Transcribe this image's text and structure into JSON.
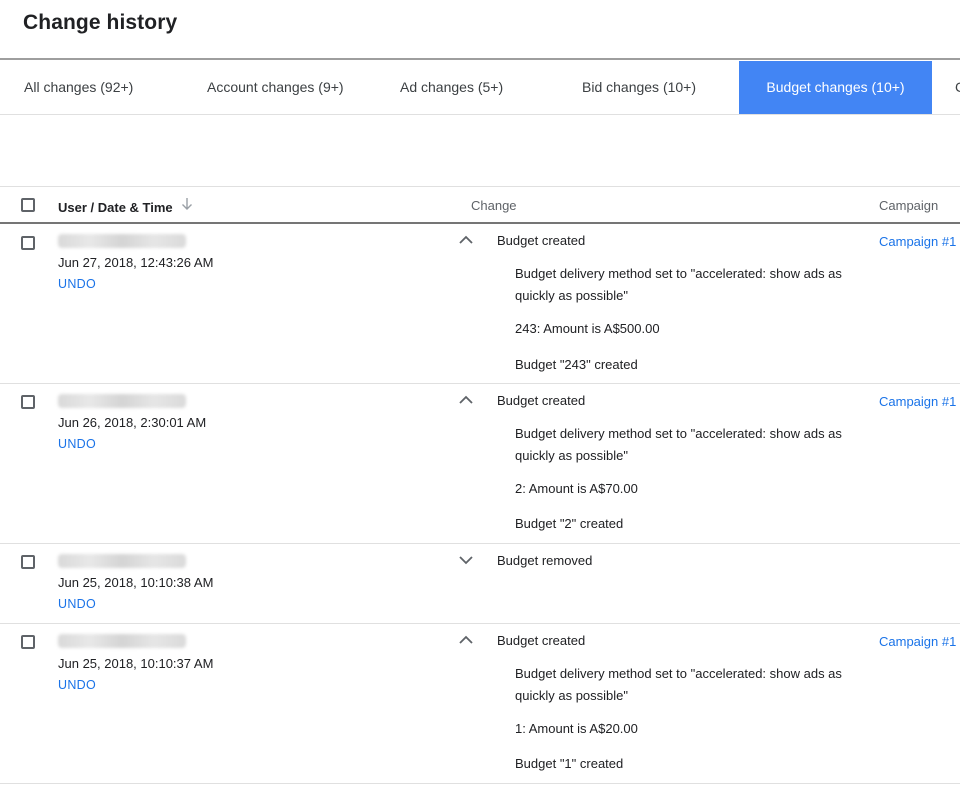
{
  "page": {
    "title": "Change history"
  },
  "tabs": [
    {
      "label": "All changes (92+)"
    },
    {
      "label": "Account changes (9+)"
    },
    {
      "label": "Ad changes (5+)"
    },
    {
      "label": "Bid changes (10+)"
    },
    {
      "label": "Budget changes (10+)",
      "active": true
    },
    {
      "label": "C"
    }
  ],
  "table": {
    "headers": {
      "user_date": "User / Date & Time",
      "change": "Change",
      "campaign": "Campaign"
    },
    "rows": [
      {
        "date": "Jun 27, 2018, 12:43:26 AM",
        "undo": "UNDO",
        "expanded": true,
        "change": "Budget created",
        "details": [
          "Budget delivery method set to \"accelerated: show ads as quickly as possible\"",
          "243: Amount is A$500.00",
          "Budget \"243\" created"
        ],
        "campaign": "Campaign #1"
      },
      {
        "date": "Jun 26, 2018, 2:30:01 AM",
        "undo": "UNDO",
        "expanded": true,
        "change": "Budget created",
        "details": [
          "Budget delivery method set to \"accelerated: show ads as quickly as possible\"",
          "2: Amount is A$70.00",
          "Budget \"2\" created"
        ],
        "campaign": "Campaign #1"
      },
      {
        "date": "Jun 25, 2018, 10:10:38 AM",
        "undo": "UNDO",
        "expanded": false,
        "change": "Budget removed",
        "details": [],
        "campaign": ""
      },
      {
        "date": "Jun 25, 2018, 10:10:37 AM",
        "undo": "UNDO",
        "expanded": true,
        "change": "Budget created",
        "details": [
          "Budget delivery method set to \"accelerated: show ads as quickly as possible\"",
          "1: Amount is A$20.00",
          "Budget \"1\" created"
        ],
        "campaign": "Campaign #1"
      }
    ]
  },
  "colors": {
    "accent": "#4285f4",
    "link": "#1a73e8",
    "text": "#202124",
    "muted": "#5f6368"
  },
  "icons": {
    "sort": "arrow-down-icon",
    "expanded": "chevron-up-icon",
    "collapsed": "chevron-down-icon"
  }
}
